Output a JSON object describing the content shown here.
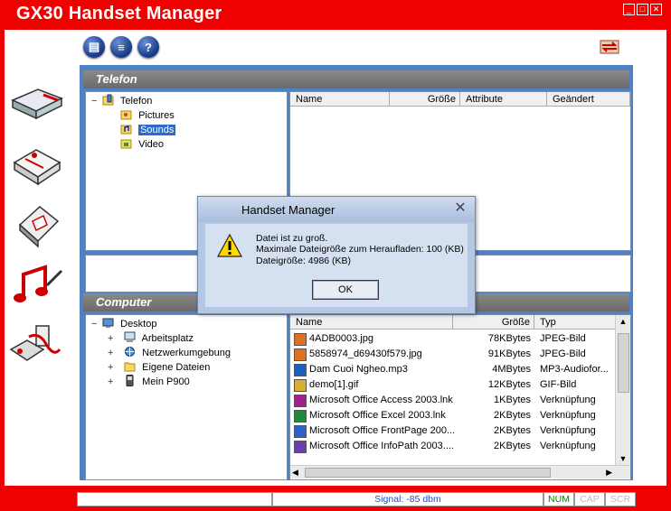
{
  "app": {
    "title": "GX30 Handset Manager",
    "window_controls": [
      "_",
      "□",
      "✕"
    ]
  },
  "toolbar": {
    "buttons": [
      {
        "name": "document-icon",
        "glyph": "▤"
      },
      {
        "name": "list-icon",
        "glyph": "≡"
      },
      {
        "name": "help-icon",
        "glyph": "?"
      }
    ]
  },
  "sidebar": {
    "items": [
      {
        "name": "phonebook-icon"
      },
      {
        "name": "messages-icon"
      },
      {
        "name": "organizer-icon"
      },
      {
        "name": "music-icon"
      },
      {
        "name": "connect-icon"
      }
    ]
  },
  "telefon": {
    "title": "Telefon",
    "tree": {
      "root": "Telefon",
      "root_expander": "−",
      "children": [
        "Pictures",
        "Sounds",
        "Video"
      ],
      "selected": "Sounds"
    },
    "columns": [
      "Name",
      "Größe",
      "Attribute",
      "Geändert"
    ]
  },
  "computer": {
    "title": "Computer",
    "tree": {
      "root": "Desktop",
      "root_expander": "−",
      "children": [
        {
          "label": "Arbeitsplatz",
          "expander": "+"
        },
        {
          "label": "Netzwerkumgebung",
          "expander": "+"
        },
        {
          "label": "Eigene Dateien",
          "expander": "+"
        },
        {
          "label": "Mein P900",
          "expander": "+"
        }
      ]
    },
    "columns": [
      "Name",
      "Größe",
      "Typ"
    ],
    "files": [
      {
        "name": "4ADB0003.jpg",
        "size": "78KBytes",
        "type": "JPEG-Bild"
      },
      {
        "name": "5858974_d69430f579.jpg",
        "size": "91KBytes",
        "type": "JPEG-Bild"
      },
      {
        "name": "Dam Cuoi Ngheo.mp3",
        "size": "4MBytes",
        "type": "MP3-Audiofor..."
      },
      {
        "name": "demo[1].gif",
        "size": "12KBytes",
        "type": "GIF-Bild"
      },
      {
        "name": "Microsoft Office Access 2003.lnk",
        "size": "1KBytes",
        "type": "Verknüpfung"
      },
      {
        "name": "Microsoft Office Excel 2003.lnk",
        "size": "2KBytes",
        "type": "Verknüpfung"
      },
      {
        "name": "Microsoft Office FrontPage 200...",
        "size": "2KBytes",
        "type": "Verknüpfung"
      },
      {
        "name": "Microsoft Office InfoPath 2003....",
        "size": "2KBytes",
        "type": "Verknüpfung"
      }
    ]
  },
  "dialog": {
    "title": "Handset Manager",
    "line1": "Datei ist zu groß.",
    "line2": "Maximale Dateigröße zum Heraufladen: 100 (KB)",
    "line3": "Dateigröße:  4986 (KB)",
    "ok": "OK",
    "close_glyph": "✕"
  },
  "statusbar": {
    "signal": "Signal: -85 dbm",
    "num": "NUM",
    "cap": "CAP",
    "scr": "SCR"
  },
  "colors": {
    "brand": "#f00000",
    "panel": "#4f82c5",
    "section_header": "#777777",
    "dialog": "#b4c8e4",
    "status_active": "#0a7a0a",
    "status_inactive": "#bbbbbb",
    "signal_text": "#1d4fc4"
  }
}
